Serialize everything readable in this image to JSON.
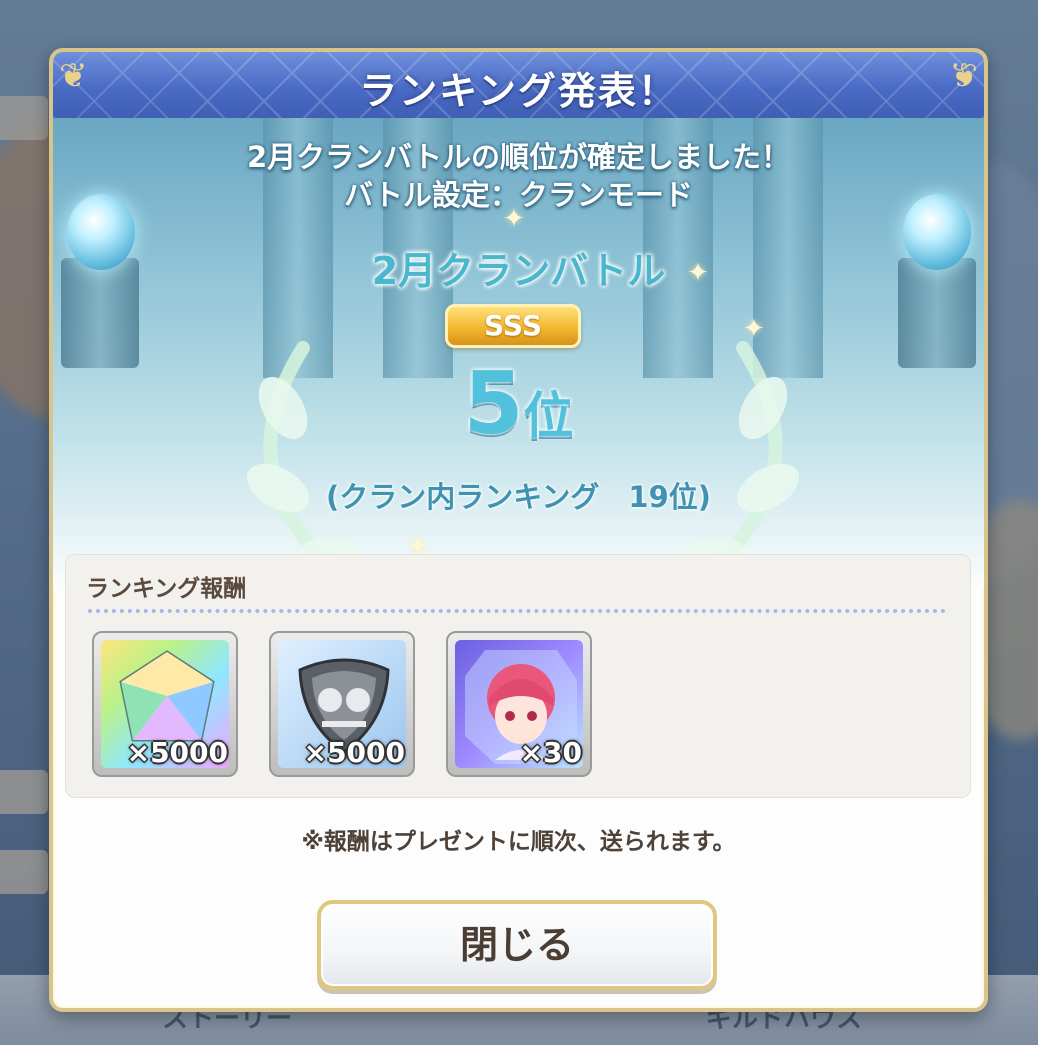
{
  "background_nav": {
    "items": [
      "ストーリー",
      "ギルドハウス"
    ]
  },
  "dialog": {
    "title": "ランキング発表！",
    "message_line1": "2月クランバトルの順位が確定しました！",
    "message_line2": "バトル設定：クランモード",
    "battle_name": "2月クランバトル",
    "rank_grade": "SSS",
    "placement_number": "5",
    "placement_unit": "位",
    "clan_internal_ranking": "(クラン内ランキング　19位)",
    "reward_section_title": "ランキング報酬",
    "rewards": [
      {
        "icon": "rainbow-jewel-icon",
        "quantity": "×5000"
      },
      {
        "icon": "clan-coin-icon",
        "quantity": "×5000"
      },
      {
        "icon": "character-memory-piece-icon",
        "quantity": "×30"
      }
    ],
    "note": "※報酬はプレゼントに順次、送られます。",
    "close_label": "閉じる"
  },
  "colors": {
    "header_blue": "#4a6bc5",
    "gold_border": "#d9c58c",
    "rank_cyan": "#52c1dc"
  }
}
